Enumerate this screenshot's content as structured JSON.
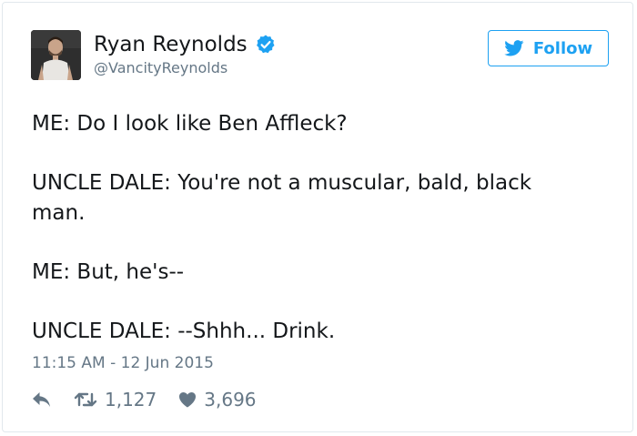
{
  "user": {
    "display_name": "Ryan Reynolds",
    "handle": "@VancityReynolds",
    "verified": true,
    "avatar_icon": "profile-photo"
  },
  "follow_button": {
    "label": "Follow",
    "icon": "twitter-bird-icon",
    "color": "#1da1f2"
  },
  "tweet": {
    "lines": [
      "ME: Do I look like Ben Affleck?",
      "UNCLE DALE: You're not a muscular, bald, black man.",
      "ME: But, he's--",
      "UNCLE DALE: --Shhh... Drink."
    ],
    "timestamp": "11:15 AM - 12 Jun 2015"
  },
  "actions": {
    "reply_icon": "reply-icon",
    "retweet_icon": "retweet-icon",
    "retweet_count": "1,127",
    "like_icon": "heart-icon",
    "like_count": "3,696"
  },
  "colors": {
    "text": "#14171a",
    "secondary": "#657786",
    "accent": "#1da1f2",
    "border": "#e1e8ed"
  }
}
